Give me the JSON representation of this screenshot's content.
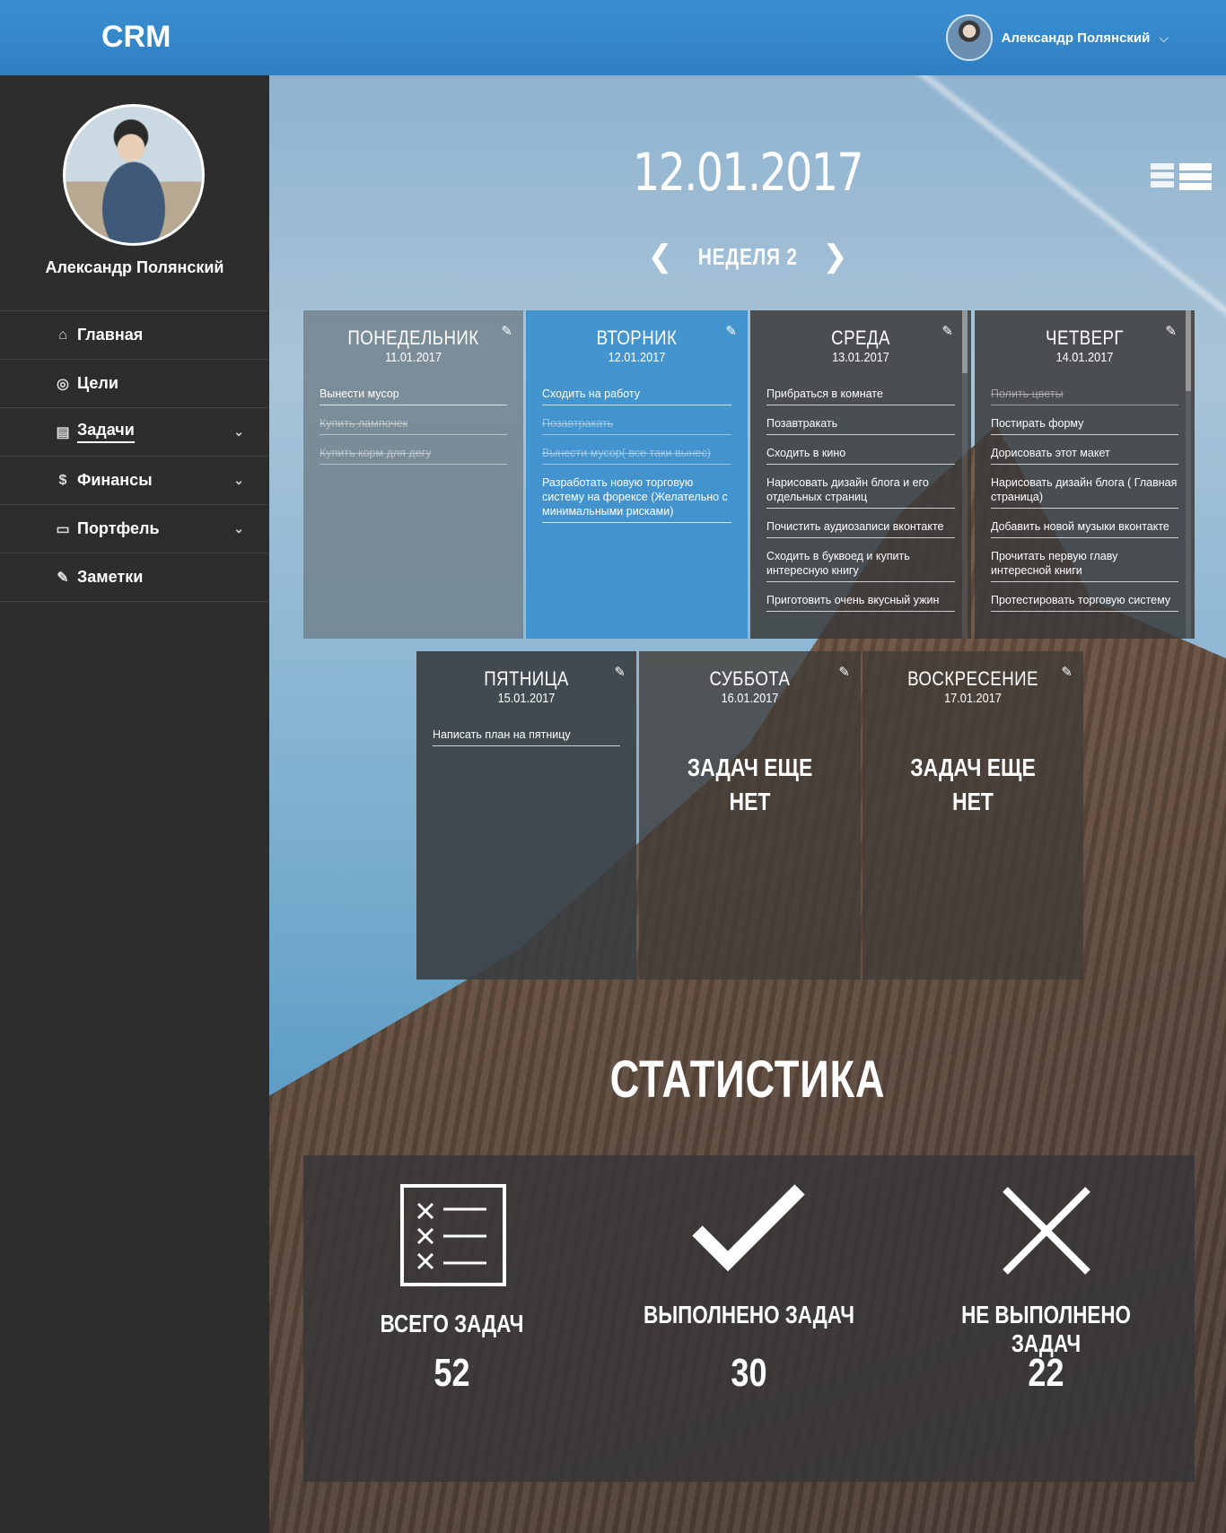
{
  "header": {
    "logo": "CRM",
    "user_name": "Александр Полянский",
    "chevron": "⌵"
  },
  "sidebar": {
    "user_name": "Александр Полянский",
    "items": [
      {
        "label": "Главная",
        "icon": "home-icon",
        "glyph": "⌂",
        "has_submenu": false
      },
      {
        "label": "Цели",
        "icon": "target-icon",
        "glyph": "◎",
        "has_submenu": false
      },
      {
        "label": "Задачи",
        "icon": "document-icon",
        "glyph": "▤",
        "has_submenu": true,
        "active": true
      },
      {
        "label": "Финансы",
        "icon": "dollar-icon",
        "glyph": "$",
        "has_submenu": true
      },
      {
        "label": "Портфель",
        "icon": "briefcase-icon",
        "glyph": "▭",
        "has_submenu": true
      },
      {
        "label": "Заметки",
        "icon": "pencil-icon",
        "glyph": "✎",
        "has_submenu": false
      }
    ]
  },
  "main": {
    "date": "12.01.2017",
    "week_label": "НЕДЕЛЯ 2",
    "prev_arrow": "❮",
    "next_arrow": "❯"
  },
  "days": {
    "mon": {
      "name": "ПОНЕДЕЛЬНИК",
      "date": "11.01.2017",
      "tasks": [
        {
          "text": "Вынести мусор",
          "done": false
        },
        {
          "text": "Купить лампочек",
          "done": true
        },
        {
          "text": "Купить корм для дегу",
          "done": true
        }
      ]
    },
    "tue": {
      "name": "ВТОРНИК",
      "date": "12.01.2017",
      "tasks": [
        {
          "text": "Сходить на работу",
          "done": false
        },
        {
          "text": "Позавтракать",
          "done": true
        },
        {
          "text": "Вынести мусор( все таки вынес)",
          "done": true
        },
        {
          "text": "Разработать новую торговую систему на форексе (Желательно с минимальными рисками)",
          "done": false
        }
      ]
    },
    "wed": {
      "name": "СРЕДА",
      "date": "13.01.2017",
      "tasks": [
        {
          "text": "Прибраться в комнате",
          "done": false
        },
        {
          "text": "Позавтракать",
          "done": false
        },
        {
          "text": "Сходить в кино",
          "done": false
        },
        {
          "text": "Нарисовать дизайн блога и его отдельных страниц",
          "done": false
        },
        {
          "text": "Почистить аудиозаписи вконтакте",
          "done": false
        },
        {
          "text": "Сходить в буквоед и купить интересную книгу",
          "done": false
        },
        {
          "text": "Приготовить очень вкусный ужин",
          "done": false
        }
      ]
    },
    "thu": {
      "name": "ЧЕТВЕРГ",
      "date": "14.01.2017",
      "tasks": [
        {
          "text": "Полить цветы",
          "done": true
        },
        {
          "text": "Постирать форму",
          "done": false
        },
        {
          "text": "Дорисовать этот макет",
          "done": false
        },
        {
          "text": "Нарисовать дизайн блога ( Главная страница)",
          "done": false
        },
        {
          "text": "Добавить новой музыки вконтакте",
          "done": false
        },
        {
          "text": "Прочитать первую главу интересной книги",
          "done": false
        },
        {
          "text": "Протестировать торговую систему",
          "done": false
        }
      ]
    },
    "fri": {
      "name": "ПЯТНИЦА",
      "date": "15.01.2017",
      "tasks": [
        {
          "text": "Написать план на пятницу",
          "done": false
        }
      ]
    },
    "sat": {
      "name": "СУББОТА",
      "date": "16.01.2017",
      "empty": "ЗАДАЧ ЕЩЕ НЕТ"
    },
    "sun": {
      "name": "ВОСКРЕСЕНИЕ",
      "date": "17.01.2017",
      "empty": "ЗАДАЧ ЕЩЕ НЕТ"
    }
  },
  "stats": {
    "title": "СТАТИСТИКА",
    "total_label": "ВСЕГО ЗАДАЧ",
    "total_value": "52",
    "done_label": "ВЫПОЛНЕНО ЗАДАЧ",
    "done_value": "30",
    "undone_label": "НЕ ВЫПОЛНЕНО ЗАДАЧ",
    "undone_value": "22"
  },
  "colors": {
    "header_blue": "#2f80c2",
    "sidebar_dark": "#2d2d2d",
    "tuesday_blue": "#3e91ce"
  }
}
